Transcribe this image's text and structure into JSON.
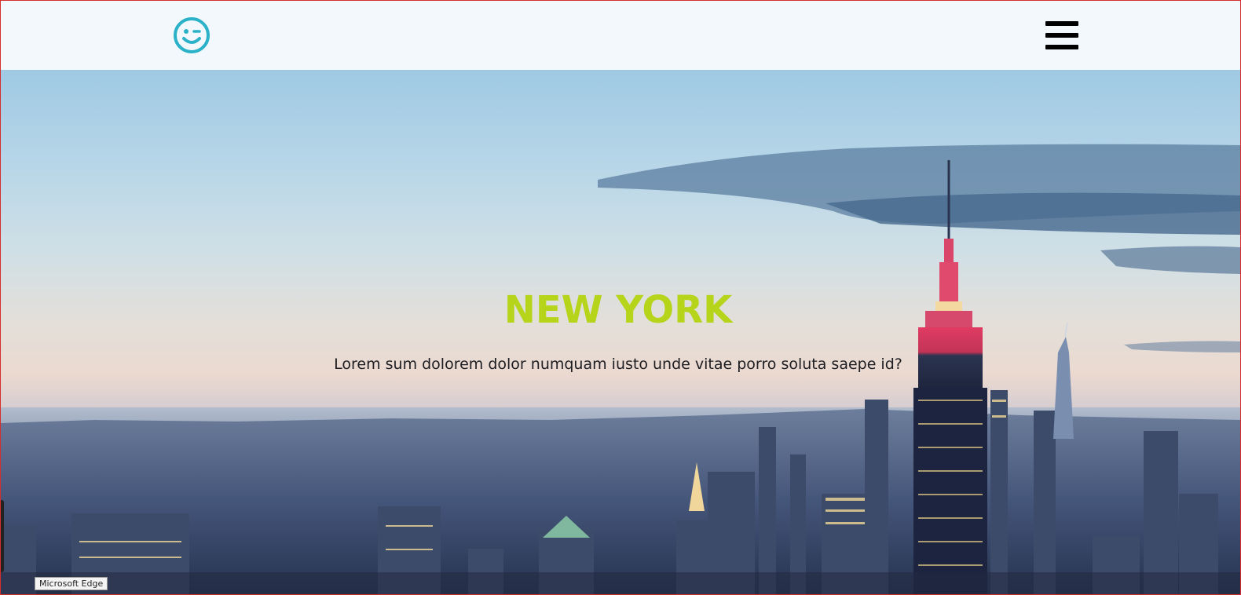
{
  "navbar": {
    "logo_icon": "winking-smiley-icon",
    "logo_color": "#2bb2c9",
    "menu_icon": "hamburger-menu-icon"
  },
  "hero": {
    "title": "NEW YORK",
    "title_color": "#b5d41a",
    "subtitle": "Lorem sum dolorem dolor numquam iusto unde vitae porro soluta saepe id?"
  },
  "tooltip": {
    "text": "Microsoft Edge"
  },
  "colors": {
    "navbar_bg": "#f3f8fd",
    "border": "#d32f2f"
  }
}
